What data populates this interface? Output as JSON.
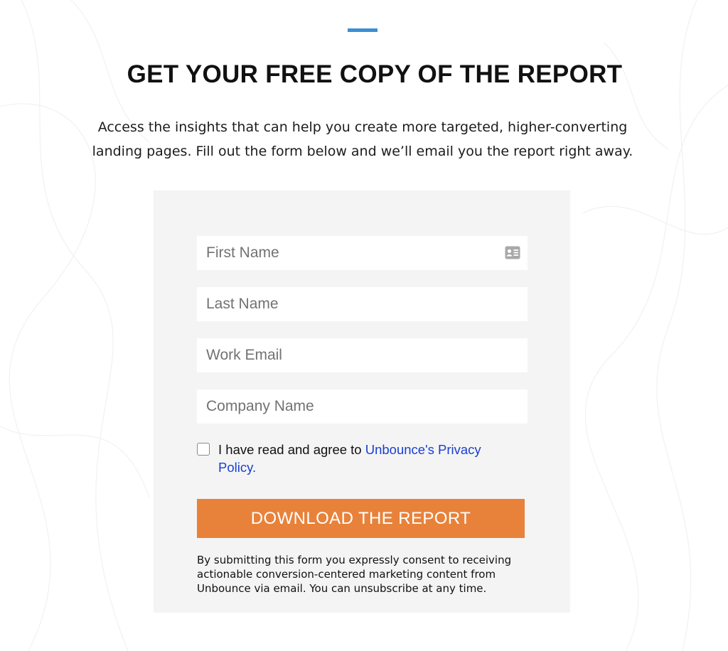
{
  "hero": {
    "headline": "GET YOUR FREE COPY OF THE REPORT",
    "intro": "Access the insights that can help you create more targeted, higher-converting landing pages. Fill out the form below and we’ll email you the report right away."
  },
  "form": {
    "fields": [
      {
        "placeholder": "First Name",
        "value": ""
      },
      {
        "placeholder": "Last Name",
        "value": ""
      },
      {
        "placeholder": "Work Email",
        "value": ""
      },
      {
        "placeholder": "Company Name",
        "value": ""
      }
    ],
    "consent": {
      "checked": false,
      "text": "I have read and agree to ",
      "link_text": "Unbounce's Privacy Policy."
    },
    "submit_label": "DOWNLOAD THE REPORT",
    "disclaimer": "By submitting this form you expressly consent to receiving actionable conversion-centered marketing content from Unbounce via email. You can unsubscribe at any time."
  },
  "colors": {
    "accent_bar": "#3b8fd4",
    "button": "#e8823a",
    "link": "#1a3fd1",
    "panel": "#f4f4f4"
  },
  "icons": {
    "first_name_field": "contact-card-icon"
  }
}
